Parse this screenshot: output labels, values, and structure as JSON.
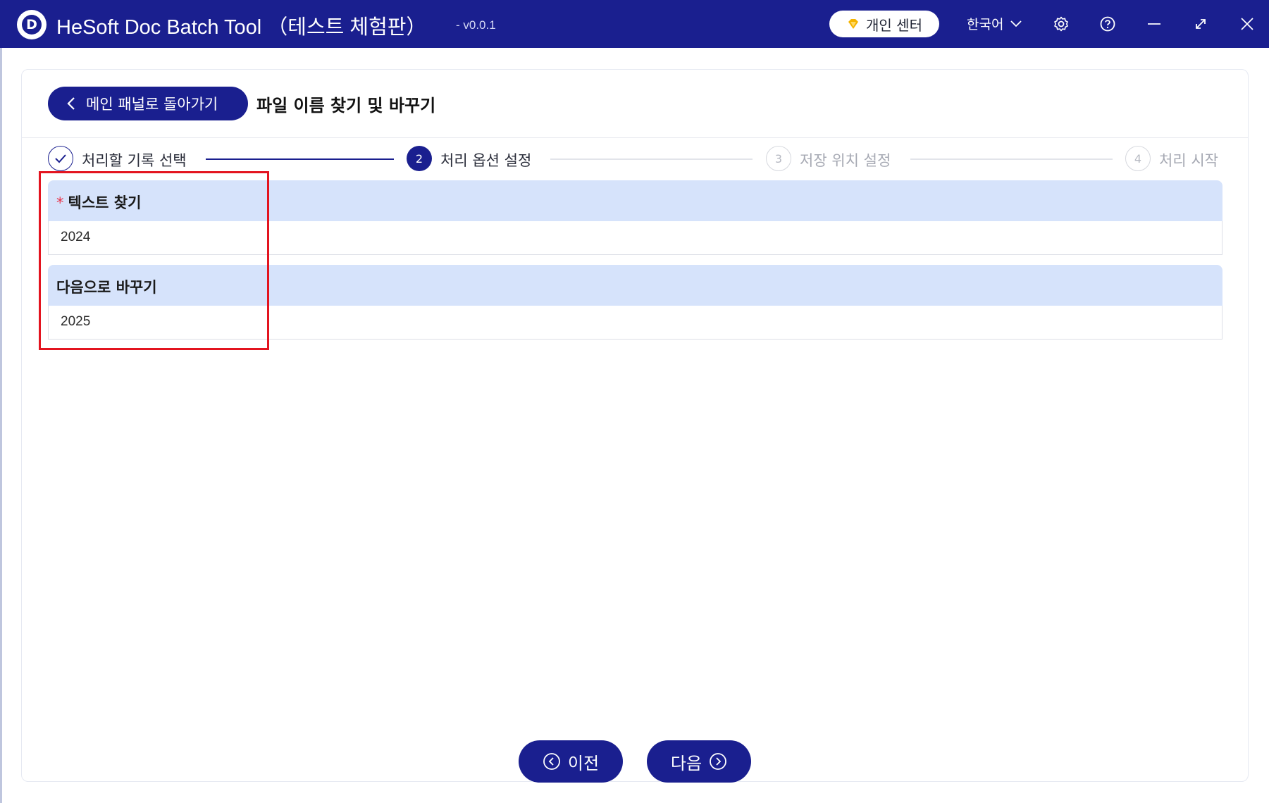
{
  "titlebar": {
    "app_name": "HeSoft Doc Batch Tool （테스트 체험판）",
    "version": "- v0.0.1",
    "personal_center": "개인 센터",
    "language": "한국어",
    "colors": {
      "bar": "#1a1f8f",
      "accent_gold": "#f5b400"
    }
  },
  "header": {
    "back_label": "메인 패널로 돌아가기",
    "page_title": "파일 이름 찾기 및 바꾸기"
  },
  "steps": [
    {
      "index": "1",
      "label": "처리할 기록 선택",
      "state": "done"
    },
    {
      "index": "2",
      "label": "처리 옵션 설정",
      "state": "active"
    },
    {
      "index": "3",
      "label": "저장 위치 설정",
      "state": "pending"
    },
    {
      "index": "4",
      "label": "처리 시작",
      "state": "pending"
    }
  ],
  "form": {
    "find": {
      "required_mark": "*",
      "label": "텍스트 찾기",
      "value": "2024"
    },
    "replace": {
      "label": "다음으로 바꾸기",
      "value": "2025"
    }
  },
  "footer": {
    "prev_label": "이전",
    "next_label": "다음"
  }
}
